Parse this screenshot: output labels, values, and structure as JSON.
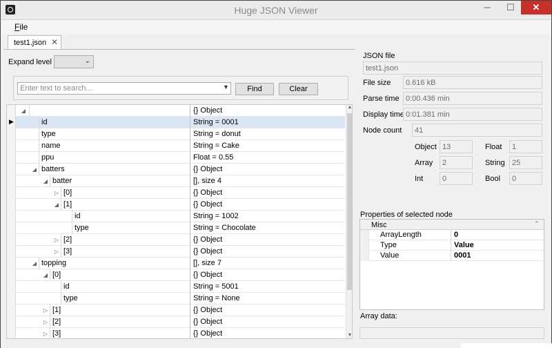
{
  "window": {
    "title": "Huge JSON Viewer",
    "min": "─",
    "max": "☐",
    "close": "✕"
  },
  "menu": {
    "file_accel": "F",
    "file_rest": "ile"
  },
  "tab": {
    "label": "test1.json",
    "close": "✕"
  },
  "left": {
    "expand_label": "Expand level",
    "expand_value": "",
    "search_placeholder": "Enter text to search...",
    "find_label": "Find",
    "clear_label": "Clear"
  },
  "tree": {
    "rows": [
      {
        "key": "",
        "value": "{} Object",
        "depth": 0,
        "expander": "collapse"
      },
      {
        "key": "id",
        "value": "String = 0001",
        "depth": 1,
        "expander": "none",
        "selected": true
      },
      {
        "key": "type",
        "value": "String = donut",
        "depth": 1,
        "expander": "none"
      },
      {
        "key": "name",
        "value": "String = Cake",
        "depth": 1,
        "expander": "none"
      },
      {
        "key": "ppu",
        "value": "Float = 0.55",
        "depth": 1,
        "expander": "none"
      },
      {
        "key": "batters",
        "value": "{} Object",
        "depth": 1,
        "expander": "collapse"
      },
      {
        "key": "batter",
        "value": "[], size 4",
        "depth": 2,
        "expander": "collapse"
      },
      {
        "key": "[0]",
        "value": "{} Object",
        "depth": 3,
        "expander": "expand"
      },
      {
        "key": "[1]",
        "value": "{} Object",
        "depth": 3,
        "expander": "collapse"
      },
      {
        "key": "id",
        "value": "String = 1002",
        "depth": 4,
        "expander": "none"
      },
      {
        "key": "type",
        "value": "String = Chocolate",
        "depth": 4,
        "expander": "none"
      },
      {
        "key": "[2]",
        "value": "{} Object",
        "depth": 3,
        "expander": "expand"
      },
      {
        "key": "[3]",
        "value": "{} Object",
        "depth": 3,
        "expander": "expand"
      },
      {
        "key": "topping",
        "value": "[], size 7",
        "depth": 1,
        "expander": "collapse"
      },
      {
        "key": "[0]",
        "value": "{} Object",
        "depth": 2,
        "expander": "collapse"
      },
      {
        "key": "id",
        "value": "String = 5001",
        "depth": 3,
        "expander": "none"
      },
      {
        "key": "type",
        "value": "String = None",
        "depth": 3,
        "expander": "none"
      },
      {
        "key": "[1]",
        "value": "{} Object",
        "depth": 2,
        "expander": "expand"
      },
      {
        "key": "[2]",
        "value": "{} Object",
        "depth": 2,
        "expander": "expand"
      },
      {
        "key": "[3]",
        "value": "{} Object",
        "depth": 2,
        "expander": "expand"
      }
    ]
  },
  "info": {
    "json_file_label": "JSON file",
    "json_file_value": "test1.json",
    "file_size_label": "File size",
    "file_size_value": "0.616 kB",
    "parse_time_label": "Parse time",
    "parse_time_value": "0:00.436 min",
    "display_time_label": "Display time",
    "display_time_value": "0:01.381 min",
    "node_count_label": "Node count",
    "node_count_value": "41",
    "object_label": "Object",
    "object_value": "13",
    "float_label": "Float",
    "float_value": "1",
    "array_label": "Array",
    "array_value": "2",
    "string_label": "String",
    "string_value": "25",
    "int_label": "Int",
    "int_value": "0",
    "bool_label": "Bool",
    "bool_value": "0"
  },
  "properties": {
    "title": "Properties of selected node",
    "category": "Misc",
    "rows": [
      {
        "name": "ArrayLength",
        "value": "0"
      },
      {
        "name": "Type",
        "value": "Value"
      },
      {
        "name": "Value",
        "value": "0001"
      }
    ]
  },
  "array_data_label": "Array data:"
}
